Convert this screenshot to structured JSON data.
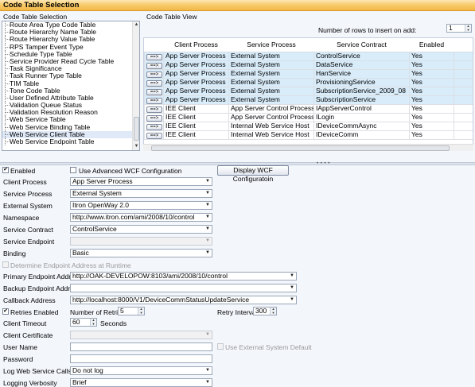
{
  "window": {
    "title": "Code Table Selection"
  },
  "selection": {
    "label": "Code Table Selection",
    "items": [
      "Route Area Type Code Table",
      "Route Hierarchy Name Table",
      "Route Hierarchy Value Table",
      "RPS Tamper Event Type",
      "Schedule Type Table",
      "Service Provider Read Cycle Table",
      "Task Significance",
      "Task Runner Type Table",
      "TIM Table",
      "Tone Code Table",
      "User Defined Attribute Table",
      "Validation Queue Status",
      "Validation Resolution Reason",
      "Web Service Table",
      "Web Service Binding Table",
      "Web Service Client Table",
      "Web Service Endpoint Table"
    ],
    "selected": "Web Service Client Table"
  },
  "view": {
    "label": "Code Table View",
    "rows_to_insert_label": "Number of rows to insert on add:",
    "rows_to_insert_value": "1",
    "columns": [
      "Client Process",
      "Service Process",
      "Service Contract",
      "Enabled"
    ],
    "row_button": "==>",
    "rows": [
      [
        "App Server Process",
        "External System",
        "ControlService",
        "Yes"
      ],
      [
        "App Server Process",
        "External System",
        "DataService",
        "Yes"
      ],
      [
        "App Server Process",
        "External System",
        "HanService",
        "Yes"
      ],
      [
        "App Server Process",
        "External System",
        "ProvisioningService",
        "Yes"
      ],
      [
        "App Server Process",
        "External System",
        "SubscriptionService_2009_08",
        "Yes"
      ],
      [
        "App Server Process",
        "External System",
        "SubscriptionService",
        "Yes"
      ],
      [
        "IEE Client",
        "App Server Control Process",
        "IAppServerControl",
        "Yes"
      ],
      [
        "IEE Client",
        "App Server Control Process",
        "ILogin",
        "Yes"
      ],
      [
        "IEE Client",
        "Internal Web Service Host",
        "IDeviceCommAsync",
        "Yes"
      ],
      [
        "IEE Client",
        "Internal Web Service Host",
        "IDeviceComm",
        "Yes"
      ]
    ]
  },
  "form": {
    "enabled_label": "Enabled",
    "enabled_checked": true,
    "wcf_label": "Use Advanced WCF Configuration",
    "wcf_checked": false,
    "display_wcf_button": "Display WCF Configuratoin",
    "client_process_label": "Client Process",
    "client_process_value": "App Server Process",
    "service_process_label": "Service Process",
    "service_process_value": "External System",
    "external_system_label": "External System",
    "external_system_value": "Itron OpenWay 2.0",
    "namespace_label": "Namespace",
    "namespace_value": "http://www.itron.com/ami/2008/10/control",
    "service_contract_label": "Service Contract",
    "service_contract_value": "ControlService",
    "service_endpoint_label": "Service Endpoint",
    "service_endpoint_value": "",
    "binding_label": "Binding",
    "binding_value": "Basic",
    "determine_endpoint_label": "Determine Endpoint Address at Runtime",
    "primary_endpoint_label": "Primary Endpoint Address",
    "primary_endpoint_value": "http://OAK-DEVELOPOW:8103/ami/2008/10/control",
    "backup_endpoint_label": "Backup Endpoint Address",
    "backup_endpoint_value": "",
    "callback_address_label": "Callback Address",
    "callback_address_value": "http://localhost:8000/V1/DeviceCommStatusUpdateService",
    "retries_enabled_label": "Retries Enabled",
    "retries_enabled_checked": true,
    "number_of_retries_label": "Number of Retries",
    "number_of_retries_value": "5",
    "retry_interval_label": "Retry Interval",
    "retry_interval_value": "300",
    "client_timeout_label": "Client Timeout",
    "client_timeout_value": "60",
    "seconds_label": "Seconds",
    "client_certificate_label": "Client Certificate",
    "client_certificate_value": "",
    "user_name_label": "User Name",
    "user_name_value": "",
    "use_external_default_label": "Use External System Default",
    "password_label": "Password",
    "password_value": "",
    "log_calls_label": "Log Web Service Calls",
    "log_calls_value": "Do not log",
    "logging_verbosity_label": "Logging Verbosity",
    "logging_verbosity_value": "Brief"
  },
  "colors": {
    "title_gradient": "#f7c863",
    "row_highlight": "#d8ecfa",
    "background": "#f3f6fb"
  }
}
